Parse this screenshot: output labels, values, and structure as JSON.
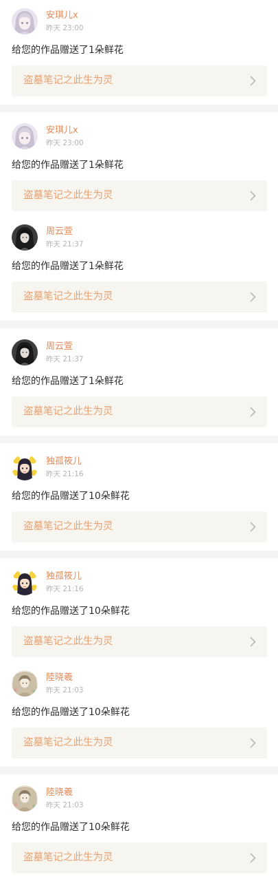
{
  "colors": {
    "name": "#e28a59",
    "work_title": "#e9a16f",
    "chevron": "#b9b9b9"
  },
  "notifications": [
    {
      "user": "安琪儿x",
      "time": "昨天 23:00",
      "message": "给您的作品赠送了1朵鲜花",
      "work": "盗墓笔记之此生为灵",
      "avatar_icon": "anime-girl-avatar-icon"
    },
    {
      "user": "安琪儿x",
      "time": "昨天 23:00",
      "message": "给您的作品赠送了1朵鲜花",
      "work": "盗墓笔记之此生为灵",
      "avatar_icon": "anime-girl-avatar-icon"
    },
    {
      "user": "周云萱",
      "time": "昨天 21:37",
      "message": "给您的作品赠送了1朵鲜花",
      "work": "盗墓笔记之此生为灵",
      "avatar_icon": "portrait-photo-avatar-icon"
    },
    {
      "user": "周云萱",
      "time": "昨天 21:37",
      "message": "给您的作品赠送了1朵鲜花",
      "work": "盗墓笔记之此生为灵",
      "avatar_icon": "portrait-photo-avatar-icon"
    },
    {
      "user": "独孤筱儿",
      "time": "昨天 21:16",
      "message": "给您的作品赠送了10朵鲜花",
      "work": "盗墓笔记之此生为灵",
      "avatar_icon": "cartoon-girl-avatar-icon"
    },
    {
      "user": "独孤筱儿",
      "time": "昨天 21:16",
      "message": "给您的作品赠送了10朵鲜花",
      "work": "盗墓笔记之此生为灵",
      "avatar_icon": "cartoon-girl-avatar-icon"
    },
    {
      "user": "陸晓羲",
      "time": "昨天 21:03",
      "message": "给您的作品赠送了10朵鲜花",
      "work": "盗墓笔记之此生为灵",
      "avatar_icon": "vintage-illustration-avatar-icon"
    },
    {
      "user": "陸晓羲",
      "time": "昨天 21:03",
      "message": "给您的作品赠送了10朵鲜花",
      "work": "盗墓笔记之此生为灵",
      "avatar_icon": "vintage-illustration-avatar-icon"
    }
  ]
}
